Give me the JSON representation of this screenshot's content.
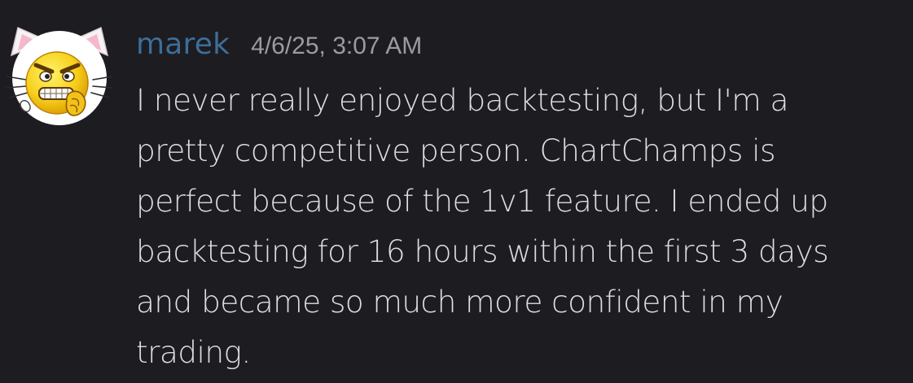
{
  "message": {
    "author": "marek",
    "timestamp": "4/6/25, 3:07 AM",
    "text": "I never really enjoyed backtesting, but I'm a\npretty competitive person. ChartChamps is\nperfect because of the 1v1 feature. I ended up\nbacktesting for 16 hours within the first 3 days\nand became so much more confident in my\ntrading.",
    "avatar": "cat-ear-grimace-emoji-avatar"
  },
  "colors": {
    "background": "#1c1c21",
    "username": "#3d6e99",
    "timestamp": "#9a9ca2",
    "text": "#dcdde1"
  }
}
